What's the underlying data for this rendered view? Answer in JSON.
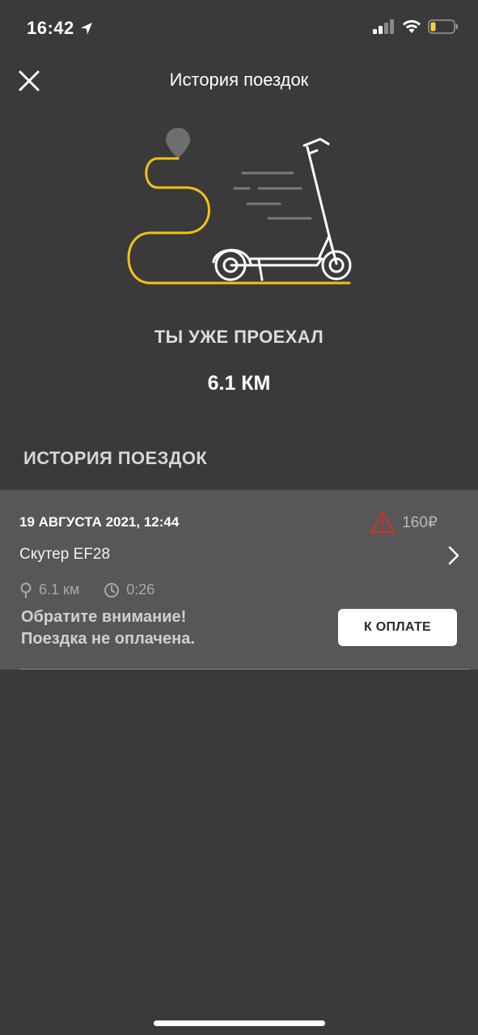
{
  "status_bar": {
    "time": "16:42",
    "battery_color": "#f2d13a"
  },
  "header": {
    "title": "История поездок"
  },
  "summary": {
    "label": "ТЫ УЖЕ ПРОЕХАЛ",
    "distance": "6.1 КМ"
  },
  "history": {
    "section_title": "ИСТОРИЯ ПОЕЗДОК",
    "trips": [
      {
        "date": "19 АВГУСТА 2021, 12:44",
        "price": "160₽",
        "vehicle": "Скутер EF28",
        "distance": "6.1 км",
        "duration": "0:26",
        "warning_line1": "Обратите внимание!",
        "warning_line2": "Поездка не оплачена.",
        "pay_label": "К ОПЛАТЕ"
      }
    ]
  },
  "colors": {
    "background": "#3a3a3a",
    "card": "#575757",
    "accent_yellow": "#f2c218",
    "warning_red": "#c0392b"
  }
}
